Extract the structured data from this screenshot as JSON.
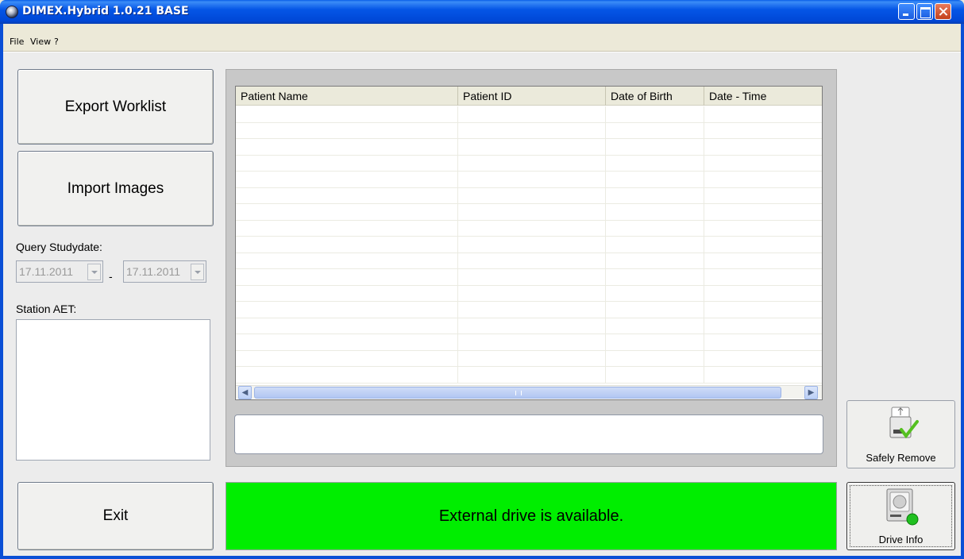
{
  "window": {
    "title": "DIMEX.Hybrid 1.0.21 BASE"
  },
  "menu": {
    "items": [
      "File",
      "View",
      "?"
    ]
  },
  "left": {
    "export_label": "Export Worklist",
    "import_label": "Import Images",
    "query_label": "Query Studydate:",
    "date_from": "17.11.2011",
    "date_sep": "-",
    "date_to": "17.11.2011",
    "station_label": "Station AET:",
    "station_value": "",
    "exit_label": "Exit"
  },
  "grid": {
    "columns": [
      "Patient Name",
      "Patient ID",
      "Date of Birth",
      "Date - Time"
    ],
    "rows": []
  },
  "info_text": "",
  "status": {
    "text": "External drive is available.",
    "color": "#00ee00"
  },
  "buttons": {
    "safely_remove": "Safely Remove",
    "drive_info": "Drive Info"
  }
}
